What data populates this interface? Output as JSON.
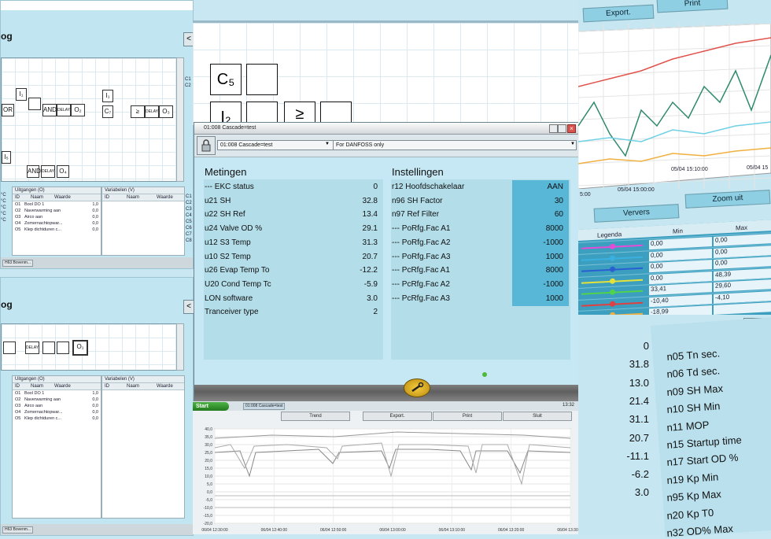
{
  "left_top": {
    "title": "og",
    "blocks": [
      "I₁",
      "OR",
      "AND",
      "DELAY",
      "O₂",
      "I₁",
      "C₇",
      "≥",
      "DELAY",
      "O₃",
      "I₅",
      "AND",
      "DELAY",
      "O₄"
    ],
    "outputs_header": "Uitgangen (O)",
    "outputs_cols": [
      "ID",
      "Naam",
      "Waarde"
    ],
    "outputs_rows": [
      {
        "id": "O1",
        "name": "Bool DO 1",
        "val": "1,0"
      },
      {
        "id": "O2",
        "name": "Naverwarming aan",
        "val": "0,0"
      },
      {
        "id": "O3",
        "name": "Airco aan",
        "val": "0,0"
      },
      {
        "id": "O4",
        "name": "Zomernachtopwar...",
        "val": "0,0"
      },
      {
        "id": "O5",
        "name": "Klep dichtduren c...",
        "val": "0,0"
      }
    ],
    "vars_header": "Variabelen (V)",
    "vars_cols": [
      "ID",
      "Naam",
      "Waarde"
    ],
    "side_codes": [
      "C1",
      "C2",
      "C3",
      "C4",
      "C5",
      "C6",
      "C7",
      "C8"
    ],
    "unit_prefix": [
      "°C",
      "°C",
      "°C",
      "°C",
      "°C"
    ],
    "taskbar": "H63 Bovenm..."
  },
  "left_bottom": {
    "title": "og",
    "blocks": [
      "DELAY",
      "O₁"
    ],
    "outputs_header": "Uitgangen (O)",
    "outputs_cols": [
      "ID",
      "Naam",
      "Waarde"
    ],
    "outputs_rows": [
      {
        "id": "O1",
        "name": "Bool DO 1",
        "val": "1,0"
      },
      {
        "id": "O2",
        "name": "Naverwarming aan",
        "val": "0,0"
      },
      {
        "id": "O3",
        "name": "Airco aan",
        "val": "0,0"
      },
      {
        "id": "O4",
        "name": "Zomernachtopwar...",
        "val": "0,0"
      },
      {
        "id": "O5",
        "name": "Klep dichtduren c...",
        "val": "0,0"
      }
    ],
    "vars_header": "Variabelen (V)",
    "vars_cols": [
      "ID",
      "Naam",
      "Waarde"
    ],
    "taskbar": "H63 Bovenm..."
  },
  "middle_top": {
    "blocks": [
      "C₅",
      "I₂",
      "≥"
    ]
  },
  "dialog": {
    "title": "01:008 Cascade=test",
    "toolbar": {
      "unit_select": "01:008 Cascade=test",
      "filter_select": "For DANFOSS only"
    },
    "metingen": {
      "heading": "Metingen",
      "rows": [
        {
          "label": "--- EKC status",
          "value": "0"
        },
        {
          "label": "u21 SH",
          "value": "32.8"
        },
        {
          "label": "u22 SH Ref",
          "value": "13.4"
        },
        {
          "label": "u24 Valve OD %",
          "value": "29.1"
        },
        {
          "label": "u12 S3 Temp",
          "value": "31.3"
        },
        {
          "label": "u10 S2 Temp",
          "value": "20.7"
        },
        {
          "label": "u26 Evap Temp To",
          "value": "-12.2"
        },
        {
          "label": "U20 Cond Temp Tc",
          "value": "-5.9"
        },
        {
          "label": "LON software",
          "value": "3.0"
        },
        {
          "label": "Tranceiver type",
          "value": "2"
        }
      ]
    },
    "instellingen": {
      "heading": "Instellingen",
      "rows": [
        {
          "label": "r12 Hoofdschakelaar",
          "value": "AAN"
        },
        {
          "label": "n96 SH Factor",
          "value": "30"
        },
        {
          "label": "n97 Ref Filter",
          "value": "60"
        },
        {
          "label": "--- PoRfg.Fac A1",
          "value": "8000"
        },
        {
          "label": "--- PoRfg.Fac A2",
          "value": "-1000"
        },
        {
          "label": "--- PoRfg.Fac A3",
          "value": "1000"
        },
        {
          "label": "--- PcRfg.Fac A1",
          "value": "8000"
        },
        {
          "label": "--- PcRfg.Fac A2",
          "value": "-1000"
        },
        {
          "label": "--- PcRfg.Fac A3",
          "value": "1000"
        }
      ]
    }
  },
  "bottom_window": {
    "start": "Start",
    "task": "01:008 Cascade=test",
    "clock": "13:32",
    "buttons": [
      "Trend",
      "Export.",
      "Print",
      "Sluit"
    ],
    "y_ticks": [
      "40,0",
      "35,0",
      "30,0",
      "25,0",
      "20,0",
      "15,0",
      "10,0",
      "5,0",
      "0,0",
      "-5,0",
      "-10,0",
      "-15,0",
      "-20,0"
    ],
    "x_ticks": [
      "06/04 12:30:00",
      "06/04 12:40:00",
      "06/04 12:50:00",
      "06/04 13:00:00",
      "06/04 13:10:00",
      "06/04 13:20:00",
      "06/04 13:30:00"
    ]
  },
  "right_top": {
    "buttons": [
      "Export.",
      "Print"
    ],
    "x_ticks": [
      "5:00",
      "05/04 15:00:00",
      "05/04 15:10:00",
      "05/04 15"
    ],
    "buttons2": [
      "Ververs",
      "Zoom uit"
    ],
    "legend_header": "Legenda",
    "min_header": "Min",
    "max_header": "Max",
    "min_vals": [
      "0,00",
      "0,00",
      "0,00",
      "0,00",
      "33,41",
      "-10,40",
      "-18,99"
    ],
    "max_vals": [
      "0,00",
      "0,00",
      "0,00",
      "48,39",
      "29,60",
      "-4,10",
      ""
    ]
  },
  "right_bottom": {
    "rows": [
      {
        "value": "0",
        "label": "n05 Tn sec."
      },
      {
        "value": "31.8",
        "label": "n06 Td sec."
      },
      {
        "value": "13.0",
        "label": "n09 SH Max"
      },
      {
        "value": "21.4",
        "label": "n10 SH Min"
      },
      {
        "value": "31.1",
        "label": "n11 MOP"
      },
      {
        "value": "20.7",
        "label": "n15 Startup time"
      },
      {
        "value": "-11.1",
        "label": "n17 Start OD %"
      },
      {
        "value": "-6.2",
        "label": "n19 Kp Min"
      },
      {
        "value": "3.0",
        "label": "n95 Kp Max"
      },
      {
        "value": "",
        "label": "n20 Kp T0"
      },
      {
        "value": "",
        "label": "n32 OD% Max"
      }
    ]
  },
  "colors": {
    "panel": "#c2e6f1",
    "value_cell": "#58b7d6",
    "dialog_bg": "#c5e8f4"
  }
}
